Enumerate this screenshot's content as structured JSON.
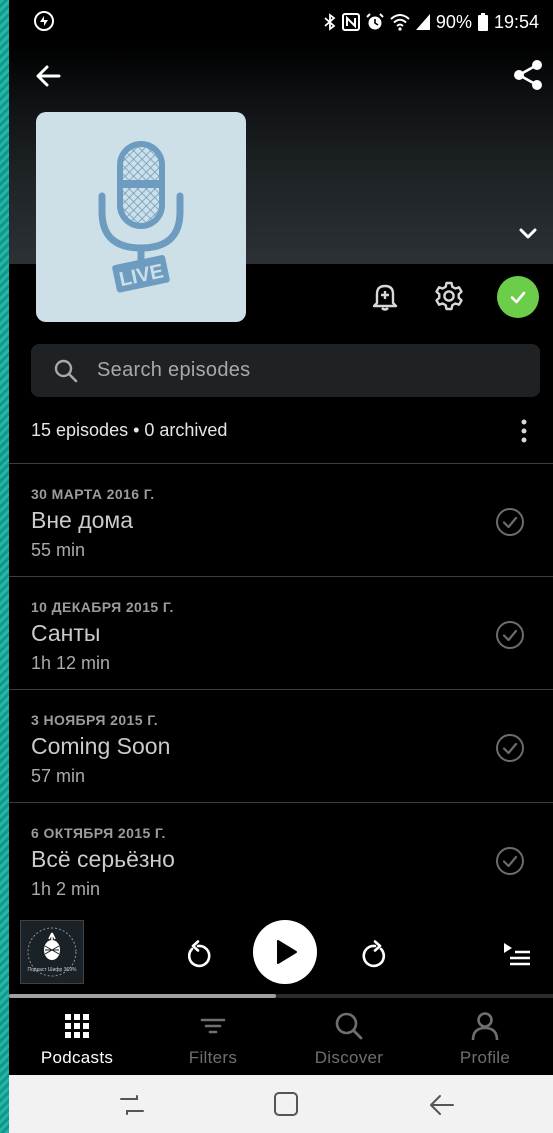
{
  "status_bar": {
    "battery": "90%",
    "time": "19:54"
  },
  "podcast": {
    "artwork_badge": "LIVE"
  },
  "search": {
    "placeholder": "Search episodes"
  },
  "episode_count": "15 episodes • 0 archived",
  "episodes": [
    {
      "date": "30 МАРТА 2016 Г.",
      "title": "Вне дома",
      "duration": "55 min",
      "played": true
    },
    {
      "date": "10 ДЕКАБРЯ 2015 Г.",
      "title": "Санты",
      "duration": "1h 12 min",
      "played": true
    },
    {
      "date": "3 НОЯБРЯ 2015 Г.",
      "title": "Coming Soon",
      "duration": "57 min",
      "played": true
    },
    {
      "date": "6 ОКТЯБРЯ 2015 Г.",
      "title": "Всё серьёзно",
      "duration": "1h 2 min",
      "played": true
    }
  ],
  "player": {
    "progress": 0.49,
    "artwork_text": "Подкаст Шифр 369%"
  },
  "tabs": [
    {
      "label": "Podcasts",
      "icon": "grid-icon",
      "active": true
    },
    {
      "label": "Filters",
      "icon": "filter-icon",
      "active": false
    },
    {
      "label": "Discover",
      "icon": "search-icon",
      "active": false
    },
    {
      "label": "Profile",
      "icon": "person-icon",
      "active": false
    }
  ],
  "colors": {
    "accent_green": "#6ccd4b",
    "background": "#000000",
    "artwork_bg": "#cde0e8",
    "artwork_icon": "#6e9cc0"
  }
}
